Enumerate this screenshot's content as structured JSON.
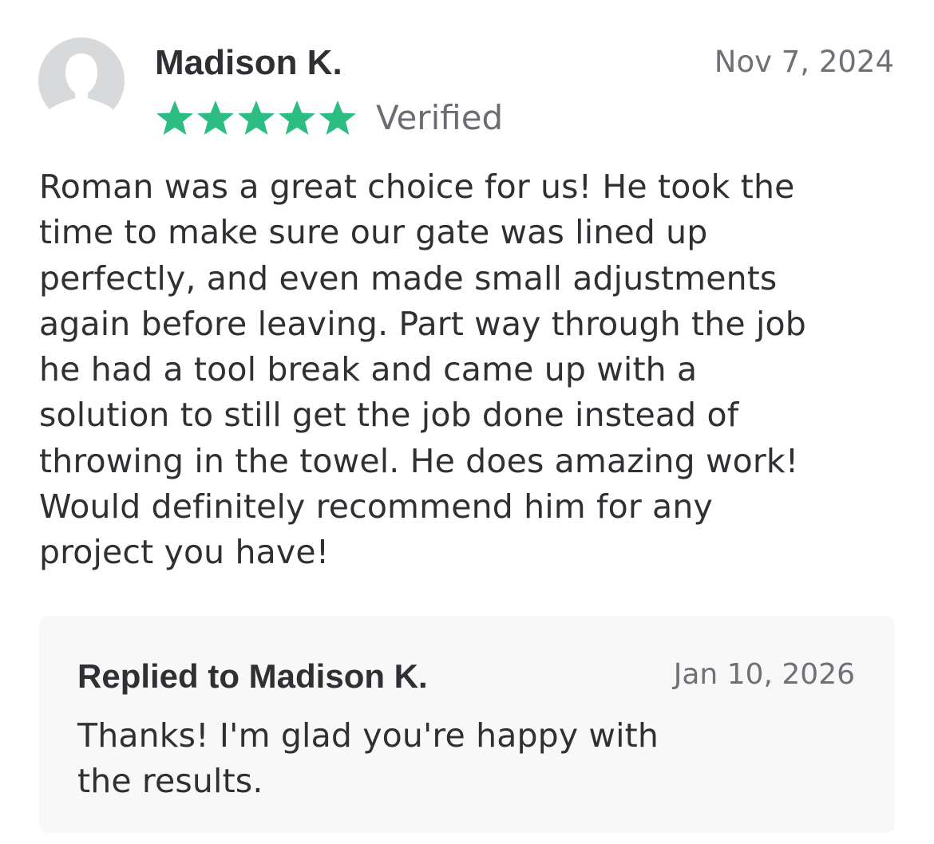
{
  "review": {
    "reviewer_name": "Madison K.",
    "date": "Nov 7, 2024",
    "rating": 5,
    "rating_max": 5,
    "verified_label": "Verified",
    "avatar_icon": "default-user-avatar-icon",
    "body_lines": [
      "Roman was a great choice for us! He took the",
      "time to make sure our gate was lined up",
      "perfectly, and even made small adjustments",
      "again before leaving. Part way through the job",
      "he had a tool break and came up with a",
      "solution to still get the job done instead of",
      "throwing in the towel. He does amazing work!",
      "Would definitely recommend him for any",
      "project you have!"
    ]
  },
  "reply": {
    "title": "Replied to Madison K.",
    "date": "Jan 10, 2026",
    "body_lines": [
      "Thanks! I'm glad you're happy with",
      "the results."
    ]
  },
  "colors": {
    "star": "#2bbd82",
    "avatar_bg": "#d8d9db",
    "avatar_figure": "#ffffff",
    "reply_bg": "#f8f8f8",
    "text": "#2f3033",
    "muted": "#6f7176"
  }
}
